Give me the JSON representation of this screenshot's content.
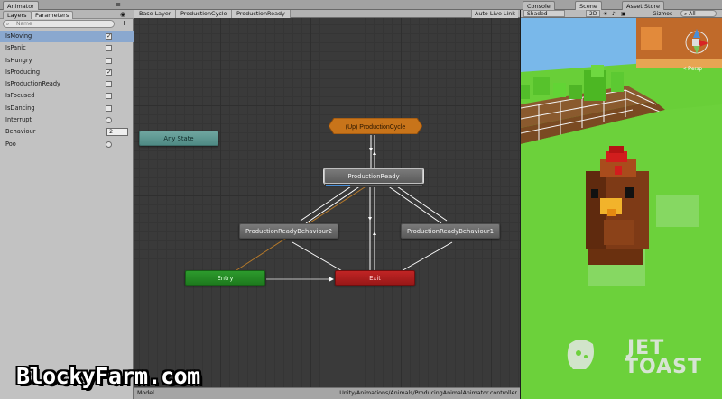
{
  "colors": {
    "grid_bg": "#3a3a3a",
    "node_gray": "#6a6a6a",
    "node_any_state": "#5f9a94",
    "node_entry": "#239023",
    "node_exit": "#b21e1e",
    "node_subsm": "#c8741a",
    "progress": "#4a8fd8",
    "selection": "#8aa8cf",
    "grass": "#6dd23c"
  },
  "animator": {
    "window_tab": "Animator",
    "panel_tabs": [
      "Layers",
      "Parameters"
    ],
    "search_placeholder": "Name",
    "parameters": [
      {
        "name": "IsMoving",
        "type": "bool",
        "value": true,
        "selected": true
      },
      {
        "name": "IsPanic",
        "type": "bool",
        "value": false
      },
      {
        "name": "IsHungry",
        "type": "bool",
        "value": false
      },
      {
        "name": "IsProducing",
        "type": "bool",
        "value": true
      },
      {
        "name": "IsProductionReady",
        "type": "bool",
        "value": false
      },
      {
        "name": "IsFocused",
        "type": "bool",
        "value": false
      },
      {
        "name": "IsDancing",
        "type": "bool",
        "value": false
      },
      {
        "name": "Interrupt",
        "type": "trigger"
      },
      {
        "name": "Behaviour",
        "type": "int",
        "value": "2"
      },
      {
        "name": "Poo",
        "type": "trigger"
      }
    ],
    "breadcrumbs": [
      "Base Layer",
      "ProductionCycle",
      "ProductionReady"
    ],
    "auto_live_link": "Auto Live Link",
    "nodes": {
      "any_state": "Any State",
      "up": "(Up) ProductionCycle",
      "production_ready": "ProductionReady",
      "behaviour2": "ProductionReadyBehaviour2",
      "behaviour1": "ProductionReadyBehaviour1",
      "entry": "Entry",
      "exit": "Exit"
    },
    "progress": 0.25,
    "status_left": "Model",
    "status_right": "Unity/Animations/Animals/ProducingAnimalAnimator.controller"
  },
  "scene": {
    "tabs": [
      "Console",
      "Scene",
      "Asset Store"
    ],
    "toolbar": {
      "shading": "Shaded",
      "mode_2d": "2D",
      "gizmos": "Gizmos",
      "search": "All"
    },
    "persp": "< Persp"
  },
  "watermark": "BlockyFarm.com",
  "logo": {
    "line1": "JET",
    "line2": "TOAST"
  }
}
